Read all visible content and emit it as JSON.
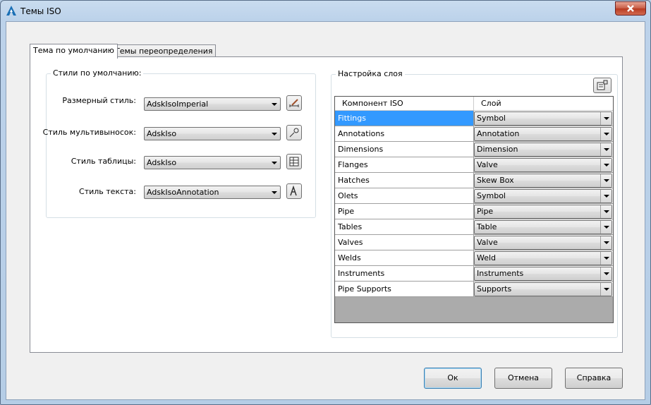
{
  "window": {
    "title": "Темы ISO"
  },
  "tabs": [
    {
      "label": "Тема по умолчанию",
      "active": true
    },
    {
      "label": "Темы переопределения",
      "active": false
    }
  ],
  "default_styles": {
    "group_title": "Стили по умолчанию:",
    "fields": [
      {
        "label": "Размерный стиль:",
        "value": "AdskIsoImperial",
        "button_icon": "dimension-style-icon"
      },
      {
        "label": "Стиль мультивыносок:",
        "value": "AdskIso",
        "button_icon": "multileader-style-icon"
      },
      {
        "label": "Стиль таблицы:",
        "value": "AdskIso",
        "button_icon": "table-style-icon"
      },
      {
        "label": "Стиль текста:",
        "value": "AdskIsoAnnotation",
        "button_icon": "text-style-icon"
      }
    ]
  },
  "layer_settings": {
    "group_title": "Настройка слоя",
    "columns": [
      "Компонент ISO",
      "Слой"
    ],
    "rows": [
      {
        "component": "Fittings",
        "layer": "Symbol",
        "selected": true
      },
      {
        "component": "Annotations",
        "layer": "Annotation"
      },
      {
        "component": "Dimensions",
        "layer": "Dimension"
      },
      {
        "component": "Flanges",
        "layer": "Valve"
      },
      {
        "component": "Hatches",
        "layer": "Skew Box"
      },
      {
        "component": "Olets",
        "layer": "Symbol"
      },
      {
        "component": "Pipe",
        "layer": "Pipe"
      },
      {
        "component": "Tables",
        "layer": "Table"
      },
      {
        "component": "Valves",
        "layer": "Valve"
      },
      {
        "component": "Welds",
        "layer": "Weld"
      },
      {
        "component": "Instruments",
        "layer": "Instruments"
      },
      {
        "component": "Pipe Supports",
        "layer": "Supports"
      }
    ]
  },
  "buttons": {
    "ok": "Ок",
    "cancel": "Отмена",
    "help": "Справка"
  },
  "colors": {
    "selection": "#3399ff",
    "frame": "#b8cfe6",
    "close": "#c75c45"
  }
}
